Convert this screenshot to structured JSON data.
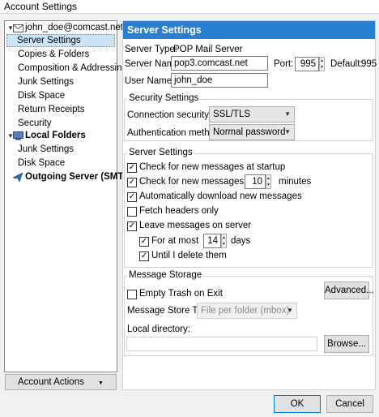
{
  "window": {
    "title": "Account Settings"
  },
  "tree": {
    "account": "john_doe@comcast.net",
    "items": [
      "Server Settings",
      "Copies & Folders",
      "Composition & Addressing",
      "Junk Settings",
      "Disk Space",
      "Return Receipts",
      "Security"
    ],
    "local_folders": "Local Folders",
    "local_items": [
      "Junk Settings",
      "Disk Space"
    ],
    "outgoing": "Outgoing Server (SMTP)",
    "selected": "Server Settings"
  },
  "account_actions": "Account Actions",
  "panel": {
    "title": "Server Settings",
    "server_type_label": "Server Type:",
    "server_type_value": "POP Mail Server",
    "server_name_label": "Server Name:",
    "server_name_value": "pop3.comcast.net",
    "port_label": "Port:",
    "port_value": "995",
    "default_label": "Default:",
    "default_value": "995",
    "user_name_label": "User Name:",
    "user_name_value": "john_doe"
  },
  "security": {
    "legend": "Security Settings",
    "connection_label": "Connection security:",
    "connection_value": "SSL/TLS",
    "auth_label": "Authentication method:",
    "auth_value": "Normal password"
  },
  "server_settings": {
    "legend": "Server Settings",
    "check_startup": "Check for new messages at startup",
    "check_every": "Check for new messages every",
    "check_every_value": "10",
    "minutes": "minutes",
    "auto_download": "Automatically download new messages",
    "fetch_headers": "Fetch headers only",
    "leave_on_server": "Leave messages on server",
    "for_at_most": "For at most",
    "days_value": "14",
    "days": "days",
    "until_delete": "Until I delete them"
  },
  "storage": {
    "legend": "Message Storage",
    "empty_trash": "Empty Trash on Exit",
    "advanced": "Advanced...",
    "store_type_label": "Message Store Type:",
    "store_type_value": "File per folder (mbox)",
    "local_dir_label": "Local directory:",
    "local_dir_value": "",
    "browse": "Browse..."
  },
  "footer": {
    "ok": "OK",
    "cancel": "Cancel"
  },
  "colors": {
    "header_bg": "#2b7fd0",
    "selected_bg": "#cce4f7"
  }
}
